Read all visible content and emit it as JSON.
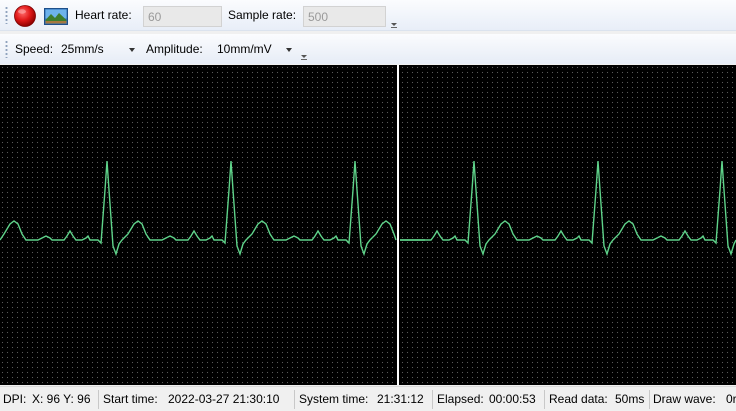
{
  "toolbar1": {
    "heart_rate_label": "Heart rate:",
    "heart_rate_value": "60",
    "sample_rate_label": "Sample rate:",
    "sample_rate_value": "500"
  },
  "toolbar2": {
    "speed_label": "Speed:",
    "speed_value": "25mm/s",
    "amplitude_label": "Amplitude:",
    "amplitude_value": "10mm/mV"
  },
  "waveform": {
    "background_color": "#000000",
    "trace_color": "#5fd38a",
    "sweep_line_color": "#ffffff",
    "beats_left_panel": 3,
    "beats_right_panel": 3
  },
  "status": {
    "dpi_label": "DPI:",
    "dpi_value": "X: 96 Y: 96",
    "start_time_label": "Start time:",
    "start_time_value": "2022-03-27 21:30:10",
    "system_time_label": "System time:",
    "system_time_value": "21:31:12",
    "elapsed_label": "Elapsed:",
    "elapsed_value": "00:00:53",
    "read_data_label": "Read data:",
    "read_data_value": "50ms",
    "draw_wave_label": "Draw wave:",
    "draw_wave_value": "0r"
  },
  "icons": {
    "record": "record-icon",
    "screenshot": "landscape-image-icon"
  }
}
